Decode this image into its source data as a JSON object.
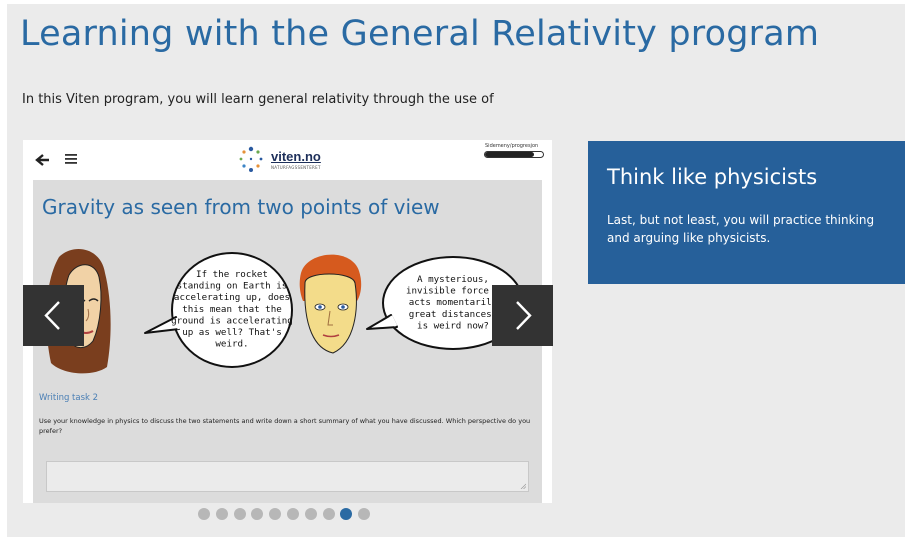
{
  "page": {
    "title": "Learning with the General Relativity program",
    "intro": "In this Viten program, you will learn general relativity through the use of"
  },
  "slide": {
    "logo_text": "viten.no",
    "logo_subtext": "NATURFAGSSENTERET",
    "progress_label": "Sidemeny/progresjon",
    "progress_fraction": 0.85,
    "heading": "Gravity as seen from two points of view",
    "bubble_left": [
      "If the rocket",
      "standing on Earth is",
      "accelerating up, does",
      "this mean that the",
      "ground is accelerating",
      "up as well? That's",
      "weird."
    ],
    "bubble_right": [
      "A mysterious,",
      "invisible force t",
      "acts momentarily",
      "great distances?",
      "is weird now?"
    ],
    "task_title": "Writing task 2",
    "task_text": "Use your knowledge in physics to discuss the two statements and write down a short summary of what you have discussed. Which perspective do you prefer?"
  },
  "carousel": {
    "dot_count": 10,
    "active_index": 8
  },
  "info_card": {
    "title": "Think like physicists",
    "body": "Last, but not least, you will practice thinking and arguing like physicists."
  },
  "colors": {
    "accent": "#2a6aa3",
    "card": "#26609a",
    "nav": "#333333",
    "dot": "#b7b7b7"
  },
  "icons": [
    "back-arrow-icon",
    "hamburger-menu-icon",
    "chevron-left-icon",
    "chevron-right-icon",
    "resize-grip-icon",
    "viten-logo"
  ]
}
